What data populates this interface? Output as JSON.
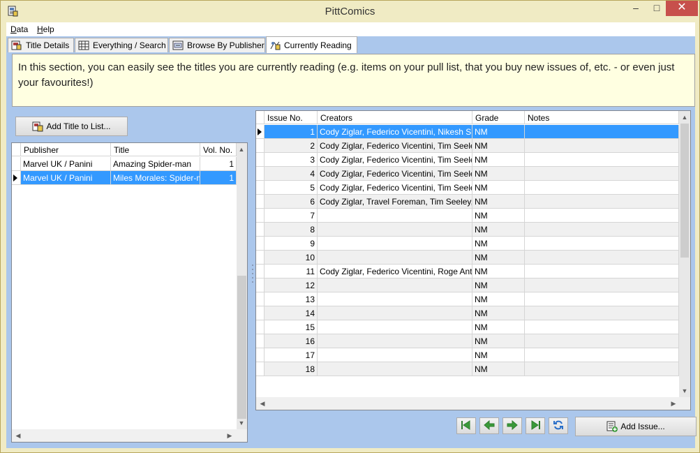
{
  "window": {
    "title": "PittComics"
  },
  "colors": {
    "selection": "#3399ff",
    "info_bg": "#ffffe1",
    "client_bg": "#abc7ec",
    "nav_green": "#3a9a3a"
  },
  "menu": [
    {
      "label": "Data",
      "underline": "D",
      "rest": "ata"
    },
    {
      "label": "Help",
      "underline": "H",
      "rest": "elp"
    }
  ],
  "tabs": [
    {
      "label": "Title Details",
      "icon": "book-icon"
    },
    {
      "label": "Everything / Search",
      "icon": "table-icon"
    },
    {
      "label": "Browse By Publisher",
      "icon": "browse-icon"
    },
    {
      "label": "Currently Reading",
      "icon": "reading-icon"
    }
  ],
  "info_text": "In this section, you can easily see the titles you are currently reading (e.g. items on your pull list, that you buy new issues of, etc. - or even just your favourites!)",
  "add_title_button": "Add Title to List...",
  "add_issue_button": "Add Issue...",
  "titles_grid": {
    "columns": [
      "Publisher",
      "Title",
      "Vol. No."
    ],
    "rows": [
      {
        "publisher": "Marvel UK / Panini",
        "title": "Amazing Spider-man",
        "vol": "1",
        "selected": false
      },
      {
        "publisher": "Marvel UK / Panini",
        "title": "Miles Morales: Spider-man",
        "vol": "1",
        "selected": true
      }
    ]
  },
  "issues_grid": {
    "columns": [
      "Issue No.",
      "Creators",
      "Grade",
      "Notes"
    ],
    "rows": [
      {
        "issue": "1",
        "creators": "Cody Ziglar, Federico Vicentini, Nikesh Shukla",
        "grade": "NM",
        "notes": "",
        "selected": true
      },
      {
        "issue": "2",
        "creators": "Cody Ziglar, Federico Vicentini, Tim Seeley",
        "grade": "NM",
        "notes": ""
      },
      {
        "issue": "3",
        "creators": "Cody Ziglar, Federico Vicentini, Tim Seeley",
        "grade": "NM",
        "notes": ""
      },
      {
        "issue": "4",
        "creators": "Cody Ziglar, Federico Vicentini, Tim Seeley",
        "grade": "NM",
        "notes": ""
      },
      {
        "issue": "5",
        "creators": "Cody Ziglar, Federico Vicentini, Tim Seeley",
        "grade": "NM",
        "notes": ""
      },
      {
        "issue": "6",
        "creators": "Cody Ziglar, Travel Foreman, Tim Seeley, ",
        "grade": "NM",
        "notes": ""
      },
      {
        "issue": "7",
        "creators": "",
        "grade": "NM",
        "notes": ""
      },
      {
        "issue": "8",
        "creators": "",
        "grade": "NM",
        "notes": ""
      },
      {
        "issue": "9",
        "creators": "",
        "grade": "NM",
        "notes": ""
      },
      {
        "issue": "10",
        "creators": "",
        "grade": "NM",
        "notes": ""
      },
      {
        "issue": "11",
        "creators": "Cody Ziglar, Federico Vicentini, Roge Antonio",
        "grade": "NM",
        "notes": ""
      },
      {
        "issue": "12",
        "creators": "",
        "grade": "NM",
        "notes": ""
      },
      {
        "issue": "13",
        "creators": "",
        "grade": "NM",
        "notes": ""
      },
      {
        "issue": "14",
        "creators": "",
        "grade": "NM",
        "notes": ""
      },
      {
        "issue": "15",
        "creators": "",
        "grade": "NM",
        "notes": ""
      },
      {
        "issue": "16",
        "creators": "",
        "grade": "NM",
        "notes": ""
      },
      {
        "issue": "17",
        "creators": "",
        "grade": "NM",
        "notes": ""
      },
      {
        "issue": "18",
        "creators": "",
        "grade": "NM",
        "notes": ""
      }
    ]
  },
  "nav_buttons": [
    {
      "name": "first-record-button",
      "icon": "first-icon"
    },
    {
      "name": "previous-record-button",
      "icon": "previous-icon"
    },
    {
      "name": "next-record-button",
      "icon": "next-icon"
    },
    {
      "name": "last-record-button",
      "icon": "last-icon"
    },
    {
      "name": "refresh-button",
      "icon": "refresh-icon"
    }
  ]
}
